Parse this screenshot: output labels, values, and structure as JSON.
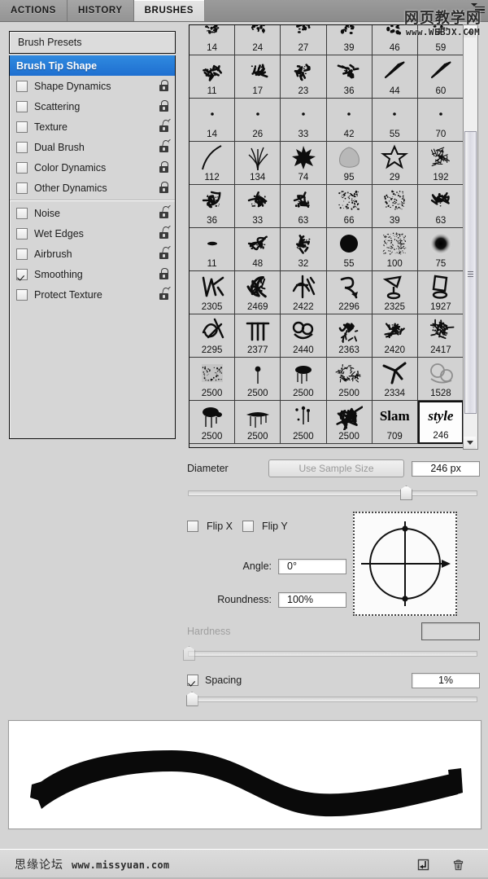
{
  "window": {
    "tabs": [
      {
        "label": "ACTIONS",
        "active": false
      },
      {
        "label": "HISTORY",
        "active": false
      },
      {
        "label": "BRUSHES",
        "active": true
      }
    ],
    "panel_menu_icon": "panel-menu-icon"
  },
  "watermark_top": {
    "text_cn": "网页教学网",
    "url": "www.WEBJX.COM"
  },
  "watermark_bottom": {
    "text_cn": "思缘论坛",
    "url": "www.missyuan.com"
  },
  "options": {
    "presets_label": "Brush Presets",
    "items": [
      {
        "label": "Brush Tip Shape",
        "checkbox": false,
        "selected": true,
        "header": true,
        "lock": "none"
      },
      {
        "label": "Shape Dynamics",
        "checkbox": false,
        "checked": false,
        "selected": false,
        "lock": "closed"
      },
      {
        "label": "Scattering",
        "checkbox": false,
        "checked": false,
        "selected": false,
        "lock": "closed"
      },
      {
        "label": "Texture",
        "checkbox": false,
        "checked": false,
        "selected": false,
        "lock": "open"
      },
      {
        "label": "Dual Brush",
        "checkbox": false,
        "checked": false,
        "selected": false,
        "lock": "open"
      },
      {
        "label": "Color Dynamics",
        "checkbox": false,
        "checked": false,
        "selected": false,
        "lock": "closed"
      },
      {
        "label": "Other Dynamics",
        "checkbox": false,
        "checked": false,
        "selected": false,
        "lock": "closed"
      },
      {
        "separator": true
      },
      {
        "label": "Noise",
        "checkbox": true,
        "checked": false,
        "selected": false,
        "lock": "open"
      },
      {
        "label": "Wet Edges",
        "checkbox": true,
        "checked": false,
        "selected": false,
        "lock": "open"
      },
      {
        "label": "Airbrush",
        "checkbox": true,
        "checked": false,
        "selected": false,
        "lock": "open"
      },
      {
        "label": "Smoothing",
        "checkbox": true,
        "checked": true,
        "selected": false,
        "lock": "closed"
      },
      {
        "label": "Protect Texture",
        "checkbox": true,
        "checked": false,
        "selected": false,
        "lock": "open"
      }
    ]
  },
  "brush_grid": {
    "selected_index": 47,
    "cells": [
      {
        "size": "14",
        "glyph": "splatter-sm"
      },
      {
        "size": "24",
        "glyph": "splatter-sm"
      },
      {
        "size": "27",
        "glyph": "splatter-sm"
      },
      {
        "size": "39",
        "glyph": "splatter-sm"
      },
      {
        "size": "46",
        "glyph": "splatter-sm"
      },
      {
        "size": "59",
        "glyph": "splatter-sm"
      },
      {
        "size": "11",
        "glyph": "chalk"
      },
      {
        "size": "17",
        "glyph": "chalk"
      },
      {
        "size": "23",
        "glyph": "chalk"
      },
      {
        "size": "36",
        "glyph": "chalk"
      },
      {
        "size": "44",
        "glyph": "rake"
      },
      {
        "size": "60",
        "glyph": "rake"
      },
      {
        "size": "14",
        "glyph": "dot"
      },
      {
        "size": "26",
        "glyph": "dot"
      },
      {
        "size": "33",
        "glyph": "dot"
      },
      {
        "size": "42",
        "glyph": "dot"
      },
      {
        "size": "55",
        "glyph": "dot"
      },
      {
        "size": "70",
        "glyph": "dot"
      },
      {
        "size": "112",
        "glyph": "arc"
      },
      {
        "size": "134",
        "glyph": "grass"
      },
      {
        "size": "74",
        "glyph": "maple-leaf"
      },
      {
        "size": "95",
        "glyph": "blob-leaf"
      },
      {
        "size": "29",
        "glyph": "star-outline"
      },
      {
        "size": "192",
        "glyph": "burst"
      },
      {
        "size": "36",
        "glyph": "scribble"
      },
      {
        "size": "33",
        "glyph": "scribble"
      },
      {
        "size": "63",
        "glyph": "scribble"
      },
      {
        "size": "66",
        "glyph": "spray-soft"
      },
      {
        "size": "39",
        "glyph": "spray-soft"
      },
      {
        "size": "63",
        "glyph": "scribble"
      },
      {
        "size": "11",
        "glyph": "flat-dash"
      },
      {
        "size": "48",
        "glyph": "scribble"
      },
      {
        "size": "32",
        "glyph": "chalk"
      },
      {
        "size": "55",
        "glyph": "hard-round"
      },
      {
        "size": "100",
        "glyph": "spray-fine"
      },
      {
        "size": "75",
        "glyph": "soft-round"
      },
      {
        "size": "2305",
        "glyph": "graffiti-a"
      },
      {
        "size": "2469",
        "glyph": "graffiti-b"
      },
      {
        "size": "2422",
        "glyph": "graffiti-c"
      },
      {
        "size": "2296",
        "glyph": "graffiti-d"
      },
      {
        "size": "2325",
        "glyph": "graffiti-e"
      },
      {
        "size": "1927",
        "glyph": "graffiti-f"
      },
      {
        "size": "2295",
        "glyph": "graffiti-g"
      },
      {
        "size": "2377",
        "glyph": "graffiti-h"
      },
      {
        "size": "2440",
        "glyph": "graffiti-i"
      },
      {
        "size": "2363",
        "glyph": "graffiti-j"
      },
      {
        "size": "2420",
        "glyph": "graffiti-k"
      },
      {
        "size": "2417",
        "glyph": "graffiti-l"
      },
      {
        "size": "2500",
        "glyph": "texture-flat"
      },
      {
        "size": "2500",
        "glyph": "drip-pin"
      },
      {
        "size": "2500",
        "glyph": "drip-blob"
      },
      {
        "size": "2500",
        "glyph": "grain-mesh"
      },
      {
        "size": "2334",
        "glyph": "arrow-tag"
      },
      {
        "size": "1528",
        "glyph": "loop-tag"
      },
      {
        "size": "2500",
        "glyph": "splat-drip"
      },
      {
        "size": "2500",
        "glyph": "streak-drip"
      },
      {
        "size": "2500",
        "glyph": "speck-drip"
      },
      {
        "size": "2500",
        "glyph": "scrub-mess"
      },
      {
        "size": "709",
        "glyph": "text-slam",
        "text": "Slam"
      },
      {
        "size": "246",
        "glyph": "text-style",
        "text": "style",
        "selected": true
      }
    ]
  },
  "controls": {
    "diameter_label": "Diameter",
    "use_sample_size_label": "Use Sample Size",
    "diameter_value": "246 px",
    "diameter_slider_pct": 75,
    "flip_x_label": "Flip X",
    "flip_x_checked": false,
    "flip_y_label": "Flip Y",
    "flip_y_checked": false,
    "angle_label": "Angle:",
    "angle_value": "0°",
    "roundness_label": "Roundness:",
    "roundness_value": "100%",
    "hardness_label": "Hardness",
    "hardness_value": "",
    "hardness_disabled": true,
    "hardness_slider_pct": 0,
    "spacing_label": "Spacing",
    "spacing_checked": true,
    "spacing_value": "1%",
    "spacing_slider_pct": 1
  },
  "status": {
    "new_brush_icon": "new-brush-icon",
    "delete_brush_icon": "trash-icon"
  },
  "colors": {
    "panel_bg": "#d4d4d4",
    "accent_selected": "#2f8ae0",
    "tab_active_bg": "#e6e6e6",
    "grid_cell_bg": "#d2d2d2",
    "ink": "#000000"
  }
}
